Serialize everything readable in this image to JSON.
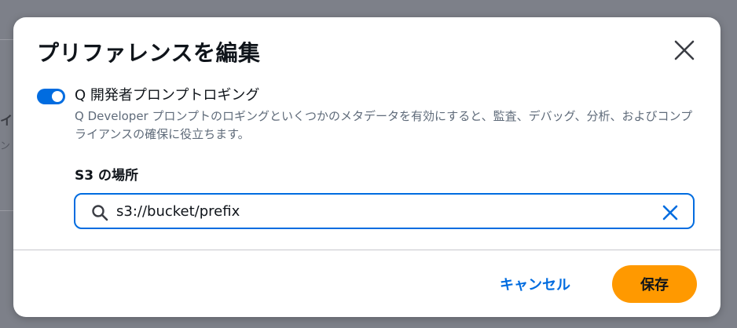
{
  "modal": {
    "title": "プリファレンスを編集",
    "toggle": {
      "label": "Q 開発者プロンプトロギング",
      "enabled": true,
      "description": "Q Developer プロンプトのロギングといくつかのメタデータを有効にすると、監査、デバッグ、分析、およびコンプライアンスの確保に役立ちます。"
    },
    "s3_field": {
      "label": "S3 の場所",
      "value": "s3://bucket/prefix",
      "icons": [
        "search-icon",
        "clear-icon"
      ]
    },
    "footer": {
      "cancel_label": "キャンセル",
      "save_label": "保存"
    },
    "colors": {
      "accent": "#006ce0",
      "primary_button": "#ff9900",
      "overlay": "#7d8089"
    }
  },
  "background": {
    "partial_text_1": "イ",
    "partial_text_2": "ン"
  }
}
